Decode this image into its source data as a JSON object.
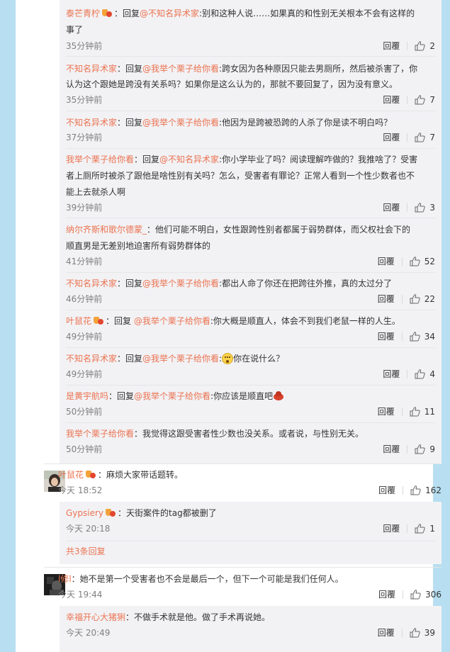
{
  "colors": {
    "accent": "#eb7350",
    "side": "#b7dff1",
    "sub_bg": "#f2f2f5"
  },
  "reply_label": "回覆",
  "thread1": {
    "replies": [
      {
        "user": "泰芒青柠",
        "vip": true,
        "prefix": "：回复",
        "mention": "@不知名异术家",
        "text1": ":别和这种人说……如果真的和性别无关根本不会有这样的",
        "text2": "事了",
        "time": "35分钟前",
        "likes": "2"
      },
      {
        "user": "不知名异术家",
        "vip": false,
        "prefix": "：回复",
        "mention": "@我举个栗子给你看",
        "text1": ":跨女因为各种原因只能去男厕所，然后被杀害了，你",
        "text2": "认为这个跟她是跨没有关系吗？如果你是这么认为的，那就不要回复了，因为没有意义。",
        "time": "35分钟前",
        "likes": "7"
      },
      {
        "user": "不知名异术家",
        "vip": false,
        "prefix": "：回复",
        "mention": "@我举个栗子给你看",
        "text1": ":他因为是跨被恐跨的人杀了你是读不明白吗？",
        "time": "37分钟前",
        "likes": "7"
      },
      {
        "user": "我举个栗子给你看",
        "vip": false,
        "prefix": "：回复",
        "mention": "@不知名异术家",
        "text1": ":你小学毕业了吗？阅读理解咋做的？我推啥了？受害",
        "text2": "者上厕所时被杀了跟他是啥性别有关吗？怎么，受害者有罪论？正常人看到一个性少数者也不",
        "text3": "能上去就杀人啊",
        "time": "39分钟前",
        "likes": "3"
      },
      {
        "user": "纳尔齐斯和歌尔德蒙_",
        "vip": false,
        "prefix": "：他们可能不明白，女性跟跨性别者都属于弱势群体，而父权社会下的",
        "mention": "",
        "text1": "",
        "text2": "顺直男是无差别地迫害所有弱势群体的",
        "time": "41分钟前",
        "likes": "52"
      },
      {
        "user": "不知名异术家",
        "vip": false,
        "prefix": "：回复",
        "mention": "@我举个栗子给你看",
        "text1": ":都出人命了你还在把跨往外推，真的太过分了",
        "time": "46分钟前",
        "likes": "22"
      },
      {
        "user": "叶鼠花",
        "vip": true,
        "prefix": "：回复 ",
        "mention": "@我举个栗子给你看",
        "text1": ":你大概是顺直人，体会不到我们老鼠一样的人生。",
        "time": "49分钟前",
        "likes": "34"
      },
      {
        "user": "不知名异术家",
        "vip": false,
        "prefix": "：回复",
        "mention": "@我举个栗子给你看",
        "text1": ":",
        "text_after_emoji": "你在说什么？",
        "time": "49分钟前",
        "likes": "4"
      },
      {
        "user": "是黄宇航吗",
        "vip": false,
        "prefix": "：回复",
        "mention": "@我举个栗子给你看",
        "text1": ":你应该是顺直吧",
        "time": "50分钟前",
        "likes": "11"
      },
      {
        "user": "我举个栗子给你看",
        "vip": false,
        "prefix": "：我觉得这跟受害者性少数也没关系。或者说，与性别无关。",
        "mention": "",
        "text1": "",
        "time": "50分钟前",
        "likes": "9"
      }
    ]
  },
  "comment2": {
    "user": "叶鼠花",
    "text": "：麻烦大家带话题转。",
    "time": "今天 18:52",
    "likes": "162",
    "replies": [
      {
        "user": "Gypsiery",
        "text": "：天街案件的tag都被删了",
        "time": "今天 20:18",
        "likes": "1"
      }
    ],
    "total_link": "共3条回复"
  },
  "comment3": {
    "user": "l修l",
    "text": "：她不是第一个受害者也不会是最后一个，但下一个可能是我们任何人。",
    "time": "今天 19:44",
    "likes": "306",
    "replies": [
      {
        "user": "幸福开心大猪猁",
        "text": "：不做手术就是他。做了手术再说她。",
        "time": "今天 20:49",
        "likes": "39"
      }
    ]
  }
}
